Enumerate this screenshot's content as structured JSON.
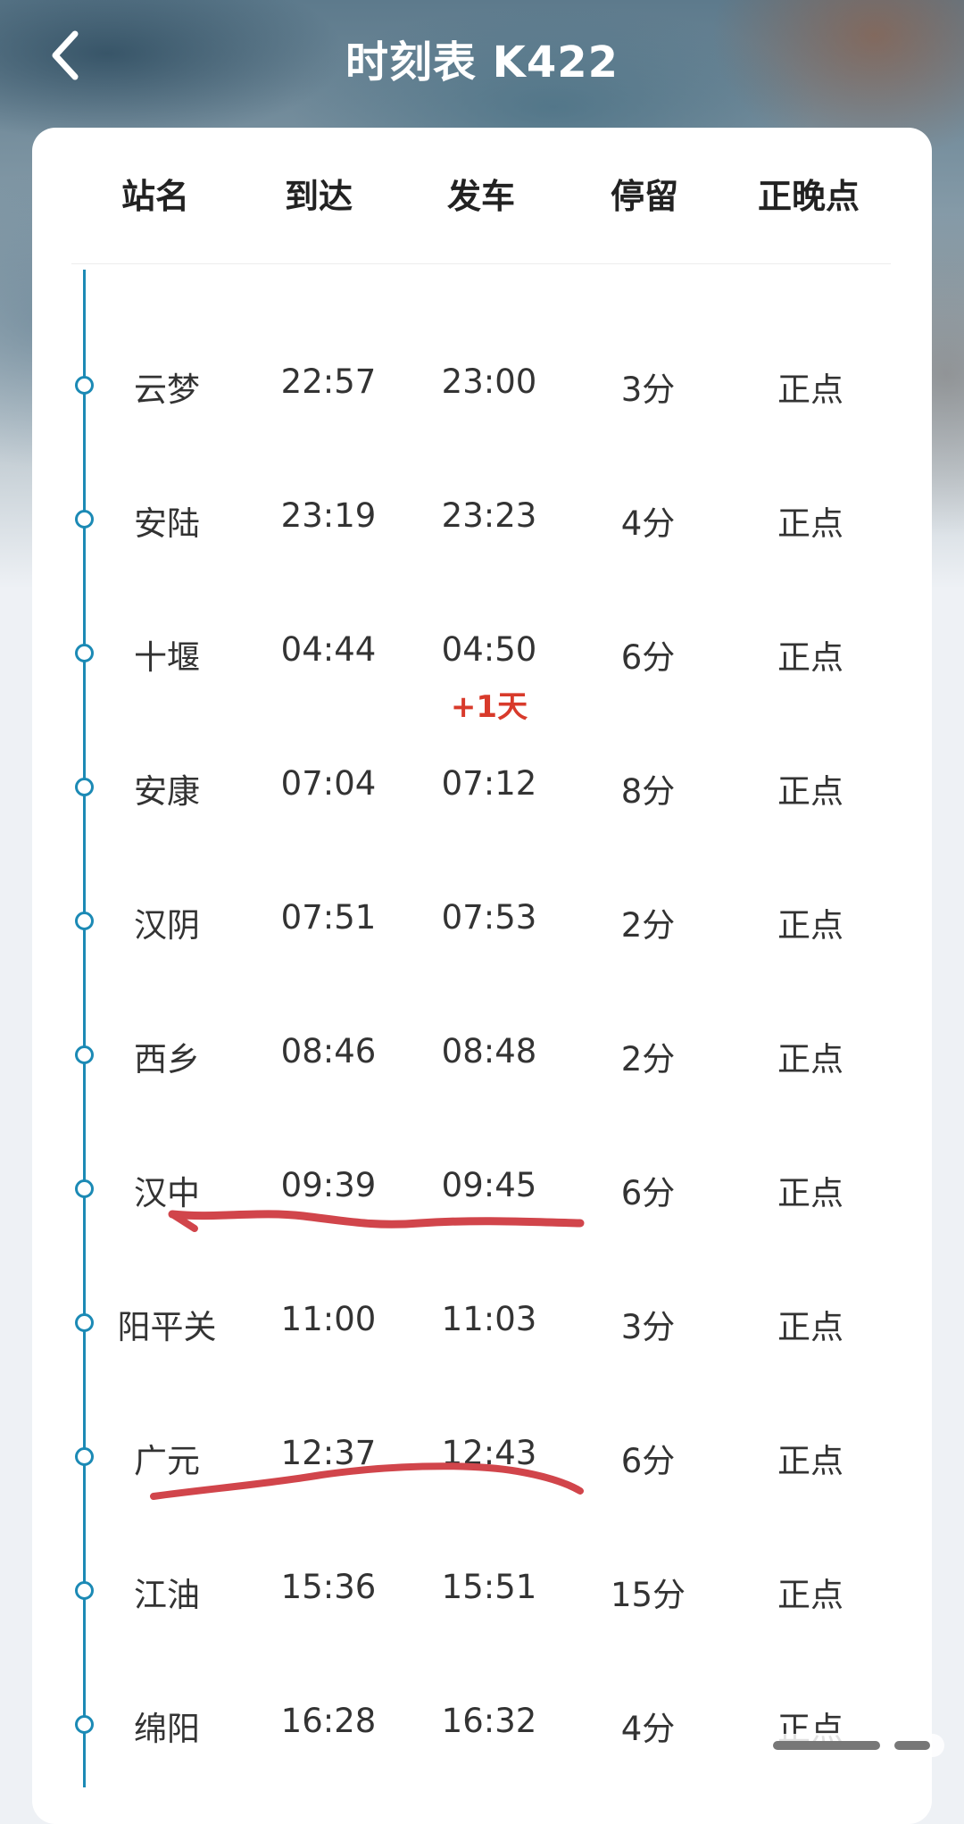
{
  "header": {
    "title": "时刻表 K422",
    "back_icon": "chevron-left-icon"
  },
  "columns": [
    "站名",
    "到达",
    "发车",
    "停留",
    "正晚点"
  ],
  "stations": [
    {
      "name": "云梦",
      "arrive": "22:57",
      "depart": "23:00",
      "stop": "3分",
      "status": "正点",
      "next_day": ""
    },
    {
      "name": "安陆",
      "arrive": "23:19",
      "depart": "23:23",
      "stop": "4分",
      "status": "正点",
      "next_day": ""
    },
    {
      "name": "十堰",
      "arrive": "04:44",
      "depart": "04:50",
      "stop": "6分",
      "status": "正点",
      "next_day": "+1天"
    },
    {
      "name": "安康",
      "arrive": "07:04",
      "depart": "07:12",
      "stop": "8分",
      "status": "正点",
      "next_day": ""
    },
    {
      "name": "汉阴",
      "arrive": "07:51",
      "depart": "07:53",
      "stop": "2分",
      "status": "正点",
      "next_day": ""
    },
    {
      "name": "西乡",
      "arrive": "08:46",
      "depart": "08:48",
      "stop": "2分",
      "status": "正点",
      "next_day": ""
    },
    {
      "name": "汉中",
      "arrive": "09:39",
      "depart": "09:45",
      "stop": "6分",
      "status": "正点",
      "next_day": ""
    },
    {
      "name": "阳平关",
      "arrive": "11:00",
      "depart": "11:03",
      "stop": "3分",
      "status": "正点",
      "next_day": ""
    },
    {
      "name": "广元",
      "arrive": "12:37",
      "depart": "12:43",
      "stop": "6分",
      "status": "正点",
      "next_day": ""
    },
    {
      "name": "江油",
      "arrive": "15:36",
      "depart": "15:51",
      "stop": "15分",
      "status": "正点",
      "next_day": ""
    },
    {
      "name": "绵阳",
      "arrive": "16:28",
      "depart": "16:32",
      "stop": "4分",
      "status": "正点",
      "next_day": ""
    }
  ],
  "colors": {
    "timeline": "#1c8ab5",
    "next_day": "#d83a2b",
    "annotation_ink": "#d1454b"
  }
}
